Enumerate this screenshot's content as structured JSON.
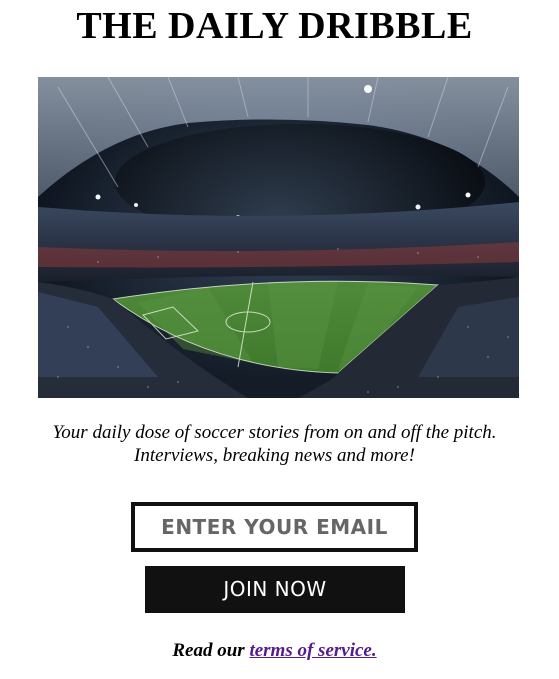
{
  "header": {
    "title": "THE DAILY DRIBBLE"
  },
  "hero": {
    "image": "stadium-photo"
  },
  "tagline": {
    "line1": "Your daily dose of soccer stories from on and off the pitch.",
    "line2": "Interviews, breaking news and more!"
  },
  "signup": {
    "email_placeholder": "ENTER YOUR EMAIL",
    "email_value": "",
    "join_label": "JOIN NOW"
  },
  "footer": {
    "terms_prefix": "Read our",
    "terms_link": "terms of service."
  },
  "colors": {
    "button_bg": "#111111",
    "button_text": "#ffffff",
    "link": "#551a8b",
    "border": "#111111"
  }
}
